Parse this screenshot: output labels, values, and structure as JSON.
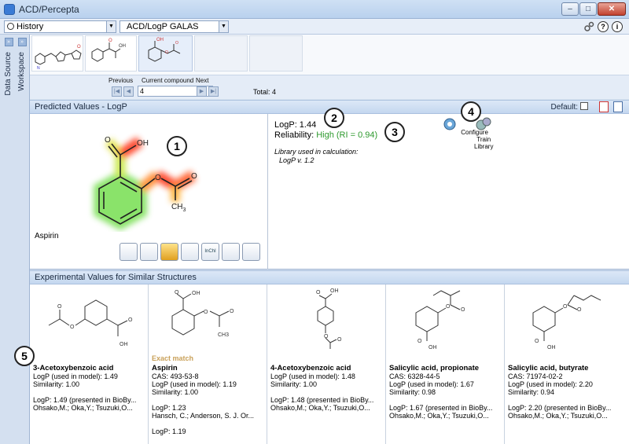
{
  "window": {
    "title": "ACD/Percepta",
    "min": "–",
    "max": "□",
    "close": "✕"
  },
  "toolbar": {
    "history": "History",
    "module": "ACD/LogP GALAS",
    "arrow": "▼",
    "help": "?",
    "info": "i"
  },
  "sidebar": {
    "data_source": "Data Source",
    "workspace": "Workspace",
    "arrow": "»"
  },
  "nav": {
    "previous": "Previous",
    "current": "Current compound",
    "next": "Next",
    "value": "4",
    "total": "Total: 4",
    "first": "|◀",
    "prev": "◀",
    "nxt": "▶",
    "last": "▶|"
  },
  "predicted": {
    "header": "Predicted Values - LogP",
    "default_label": "Default:",
    "compound_name": "Aspirin",
    "logp": "LogP: 1.44",
    "reliability_label": "Reliability:",
    "reliability_value": "High (RI = 0.94)",
    "library_line1": "Library used in calculation:",
    "library_line2": "LogP v. 1.2",
    "configure": "Configure",
    "train1": "Train",
    "train2": "Library",
    "atom_oh": "OH",
    "atom_o": "O",
    "atom_ch3": "CH",
    "atom_sub3": "3",
    "buttons": [
      "",
      "",
      "",
      "",
      "InChI",
      "",
      ""
    ]
  },
  "experimental": {
    "header": "Experimental Values for Similar Structures",
    "exact_match": "Exact match",
    "cards": [
      {
        "name": "3-Acetoxybenzoic acid",
        "cas": "",
        "logp_model": "LogP (used in model): 1.49",
        "similarity": "Similarity: 1.00",
        "logp_pres": "LogP: 1.49 (presented in BioBy...",
        "authors": "Ohsako,M.; Oka,Y.; Tsuzuki,O...",
        "extra": ""
      },
      {
        "name": "Aspirin",
        "cas": "CAS: 493-53-8",
        "logp_model": "LogP (used in model): 1.19",
        "similarity": "Similarity: 1.00",
        "logp_pres": "LogP: 1.23",
        "authors": "Hansch, C.; Anderson, S. J. Or...",
        "extra": "LogP: 1.19"
      },
      {
        "name": "4-Acetoxybenzoic acid",
        "cas": "",
        "logp_model": "LogP (used in model): 1.48",
        "similarity": "Similarity: 1.00",
        "logp_pres": "LogP: 1.48 (presented in BioBy...",
        "authors": "Ohsako,M.; Oka,Y.; Tsuzuki,O...",
        "extra": ""
      },
      {
        "name": "Salicylic acid, propionate",
        "cas": "CAS: 6328-44-5",
        "logp_model": "LogP (used in model): 1.67",
        "similarity": "Similarity: 0.98",
        "logp_pres": "LogP: 1.67 (presented in BioBy...",
        "authors": "Ohsako,M.; Oka,Y.; Tsuzuki,O...",
        "extra": ""
      },
      {
        "name": "Salicylic acid, butyrate",
        "cas": "CAS: 71974-02-2",
        "logp_model": "LogP (used in model): 2.20",
        "similarity": "Similarity: 0.94",
        "logp_pres": "LogP: 2.20 (presented in BioBy...",
        "authors": "Ohsako,M.; Oka,Y.; Tsuzuki,O...",
        "extra": ""
      }
    ],
    "atoms": {
      "oh": "OH",
      "o": "O",
      "ch3": "CH3"
    }
  },
  "callouts": [
    "1",
    "2",
    "3",
    "4",
    "5"
  ],
  "colors": {
    "accent": "#3a7bd5",
    "reliability": "#2e9a2e",
    "exact_match": "#c9a15a",
    "heat_green": "#7ee05a",
    "heat_red": "#ff3b1e"
  }
}
